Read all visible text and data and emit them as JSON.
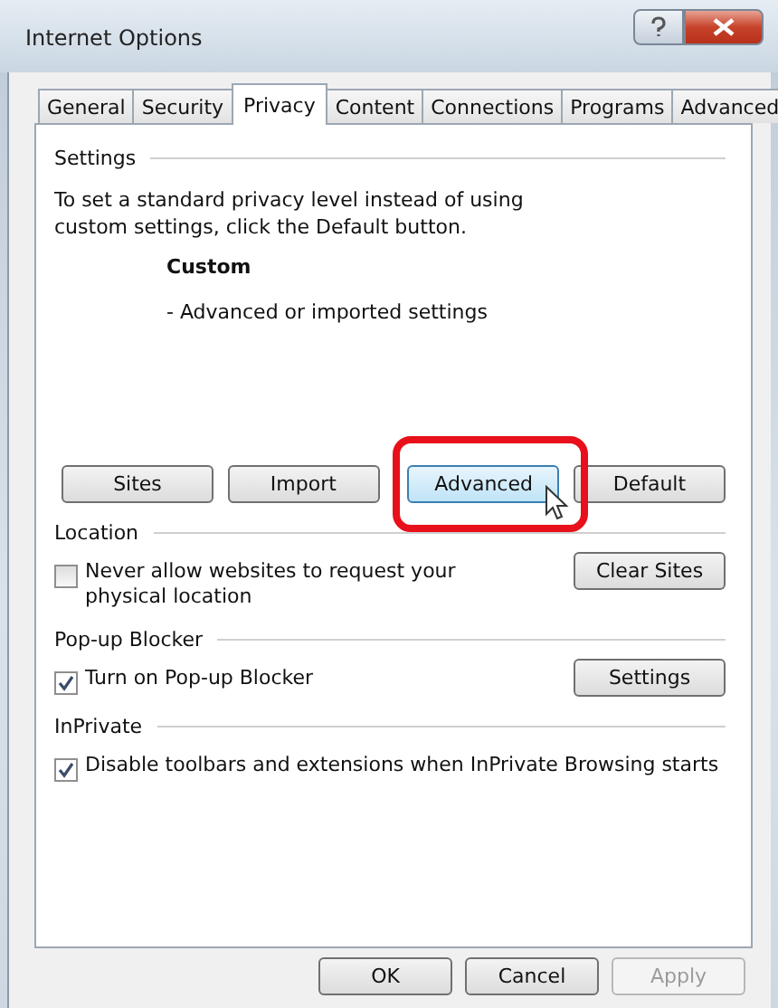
{
  "window": {
    "title": "Internet Options"
  },
  "tabs": [
    {
      "label": "General",
      "selected": false
    },
    {
      "label": "Security",
      "selected": false
    },
    {
      "label": "Privacy",
      "selected": true
    },
    {
      "label": "Content",
      "selected": false
    },
    {
      "label": "Connections",
      "selected": false
    },
    {
      "label": "Programs",
      "selected": false
    },
    {
      "label": "Advanced",
      "selected": false
    }
  ],
  "settings": {
    "heading": "Settings",
    "description": "To set a standard privacy level instead of using custom settings, click the Default button.",
    "level_name": "Custom",
    "level_detail": "- Advanced or imported settings",
    "buttons": [
      {
        "label": "Sites",
        "highlighted": false
      },
      {
        "label": "Import",
        "highlighted": false
      },
      {
        "label": "Advanced",
        "highlighted": true
      },
      {
        "label": "Default",
        "highlighted": false
      }
    ]
  },
  "location": {
    "heading": "Location",
    "checkbox": {
      "label": "Never allow websites to request your physical location",
      "checked": false
    },
    "button": "Clear Sites"
  },
  "popup_blocker": {
    "heading": "Pop-up Blocker",
    "checkbox": {
      "label": "Turn on Pop-up Blocker",
      "checked": true
    },
    "button": "Settings"
  },
  "inprivate": {
    "heading": "InPrivate",
    "checkbox": {
      "label": "Disable toolbars and extensions when InPrivate Browsing starts",
      "checked": true
    }
  },
  "footer": [
    {
      "label": "OK",
      "disabled": false
    },
    {
      "label": "Cancel",
      "disabled": false
    },
    {
      "label": "Apply",
      "disabled": true
    }
  ]
}
